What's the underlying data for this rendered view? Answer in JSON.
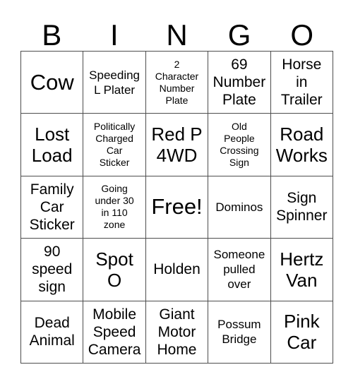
{
  "card": {
    "header_letters": [
      "B",
      "I",
      "N",
      "G",
      "O"
    ],
    "colors": {
      "background": "#ffffff",
      "text": "#000000",
      "grid_line": "#4d4d4d"
    },
    "rows": [
      [
        {
          "text": "Cow",
          "size": "xl"
        },
        {
          "text": "Speeding\nL Plater",
          "size": "sm"
        },
        {
          "text": "2\nCharacter\nNumber\nPlate",
          "size": "xs"
        },
        {
          "text": "69\nNumber\nPlate",
          "size": "md"
        },
        {
          "text": "Horse\nin\nTrailer",
          "size": "md"
        }
      ],
      [
        {
          "text": "Lost\nLoad",
          "size": "lg"
        },
        {
          "text": "Politically\nCharged\nCar\nSticker",
          "size": "xs"
        },
        {
          "text": "Red P\n4WD",
          "size": "lg"
        },
        {
          "text": "Old\nPeople\nCrossing\nSign",
          "size": "xs"
        },
        {
          "text": "Road\nWorks",
          "size": "lg"
        }
      ],
      [
        {
          "text": "Family\nCar\nSticker",
          "size": "md"
        },
        {
          "text": "Going\nunder 30\nin 110\nzone",
          "size": "xs"
        },
        {
          "text": "Free!",
          "size": "xl"
        },
        {
          "text": "Dominos",
          "size": "sm"
        },
        {
          "text": "Sign\nSpinner",
          "size": "md"
        }
      ],
      [
        {
          "text": "90\nspeed\nsign",
          "size": "md"
        },
        {
          "text": "Spot\nO",
          "size": "lg"
        },
        {
          "text": "Holden",
          "size": "md"
        },
        {
          "text": "Someone\npulled\nover",
          "size": "sm"
        },
        {
          "text": "Hertz\nVan",
          "size": "lg"
        }
      ],
      [
        {
          "text": "Dead\nAnimal",
          "size": "md"
        },
        {
          "text": "Mobile\nSpeed\nCamera",
          "size": "md"
        },
        {
          "text": "Giant\nMotor\nHome",
          "size": "md"
        },
        {
          "text": "Possum\nBridge",
          "size": "sm"
        },
        {
          "text": "Pink\nCar",
          "size": "lg"
        }
      ]
    ]
  }
}
